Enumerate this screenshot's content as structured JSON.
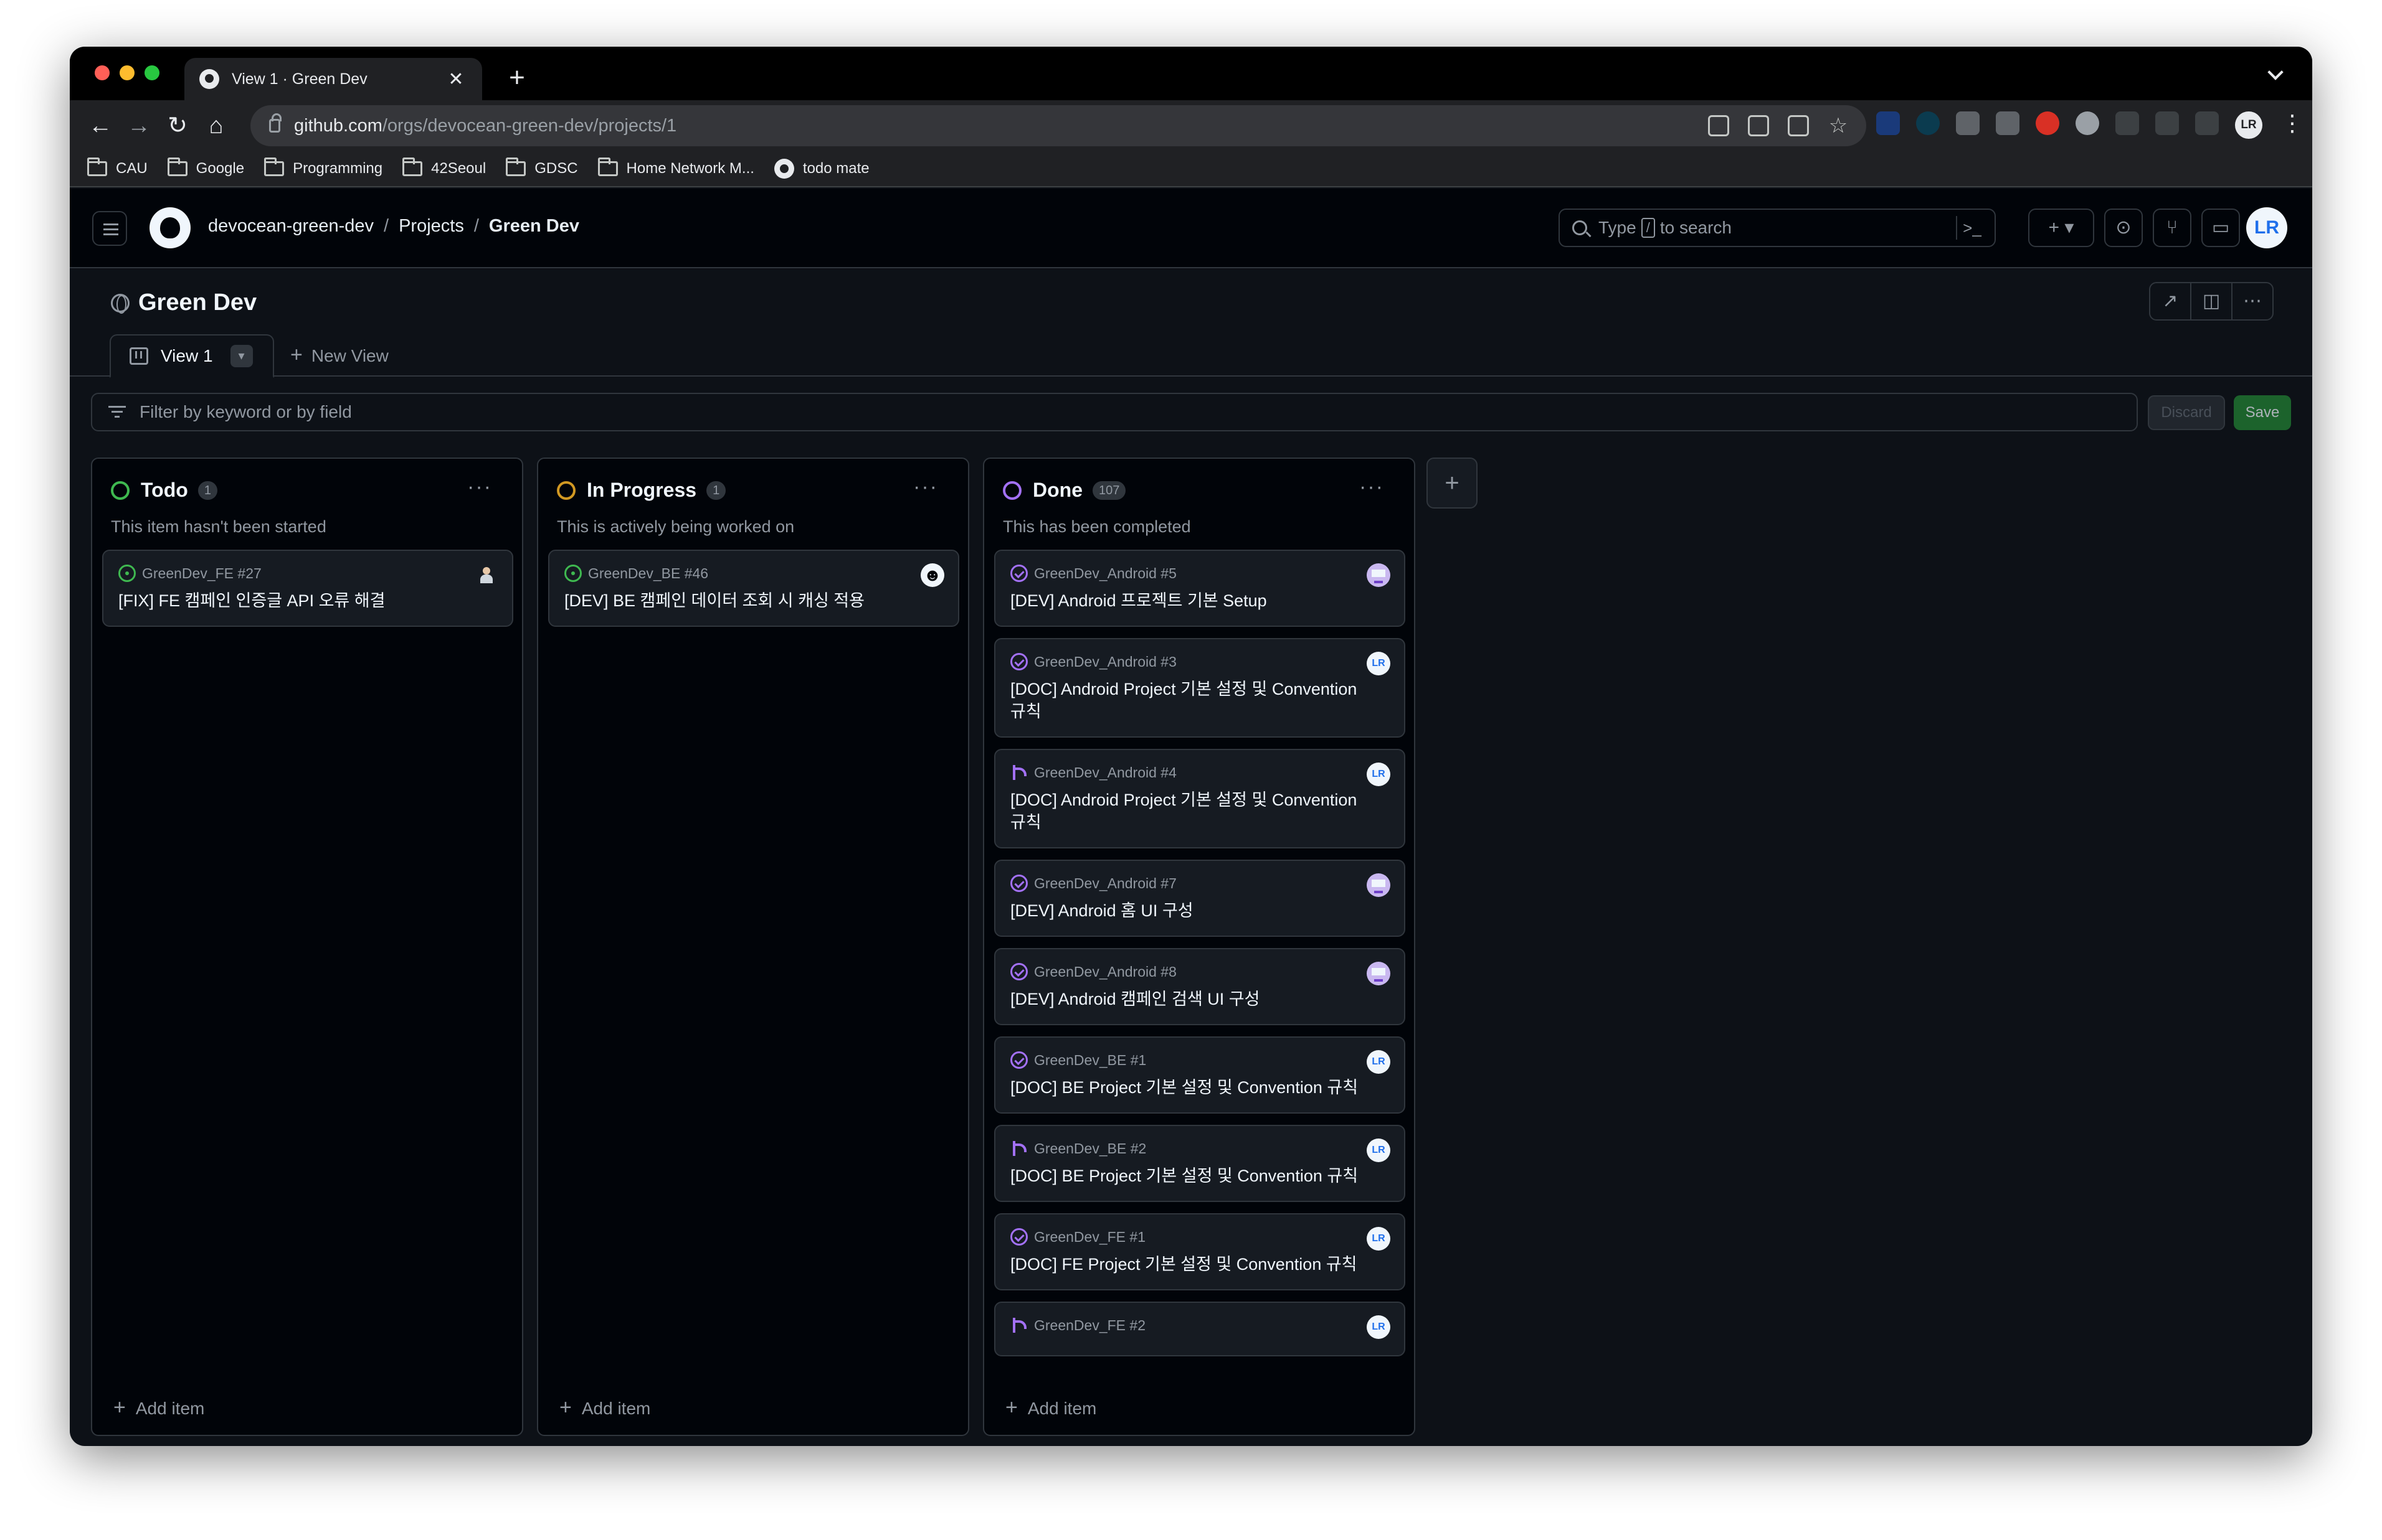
{
  "browser": {
    "tab_title": "View 1 · Green Dev",
    "url_host": "github.com",
    "url_path": "/orgs/devocean-green-dev/projects/1",
    "profile_initials": "LR",
    "bookmarks": [
      "CAU",
      "Google",
      "Programming",
      "42Seoul",
      "GDSC",
      "Home Network M...",
      "todo mate"
    ]
  },
  "header": {
    "breadcrumb": [
      "devocean-green-dev",
      "Projects",
      "Green Dev"
    ],
    "search_prefix": "Type",
    "search_key": "/",
    "search_suffix": "to search",
    "avatar_initials": "LR"
  },
  "project": {
    "title": "Green Dev",
    "view_tab": "View 1",
    "new_view": "New View",
    "filter_placeholder": "Filter by keyword or by field",
    "discard": "Discard",
    "save": "Save"
  },
  "columns": [
    {
      "name": "Todo",
      "count": "1",
      "description": "This item hasn't been started",
      "color": "#3fb950",
      "cards": [
        {
          "ref": "GreenDev_FE #27",
          "title": "[FIX] FE 캠페인 인증글 API 오류 해결",
          "state": "open",
          "assignee": "person"
        }
      ]
    },
    {
      "name": "In Progress",
      "count": "1",
      "description": "This is actively being worked on",
      "color": "#d29922",
      "cards": [
        {
          "ref": "GreenDev_BE #46",
          "title": "[DEV] BE 캠페인 데이터 조회 시 캐싱 적용",
          "state": "open",
          "assignee": "smile"
        }
      ]
    },
    {
      "name": "Done",
      "count": "107",
      "description": "This has been completed",
      "color": "#a371f7",
      "cards": [
        {
          "ref": "GreenDev_Android #5",
          "title": "[DEV] Android 프로젝트 기본 Setup",
          "state": "closed",
          "assignee": "pixel"
        },
        {
          "ref": "GreenDev_Android #3",
          "title": "[DOC] Android Project 기본 설정 및 Convention 규칙",
          "state": "closed",
          "assignee": "LR"
        },
        {
          "ref": "GreenDev_Android #4",
          "title": "[DOC] Android Project 기본 설정 및 Convention 규칙",
          "state": "merged",
          "assignee": "LR"
        },
        {
          "ref": "GreenDev_Android #7",
          "title": "[DEV] Android 홈 UI 구성",
          "state": "closed",
          "assignee": "pixel"
        },
        {
          "ref": "GreenDev_Android #8",
          "title": "[DEV] Android 캠페인 검색 UI 구성",
          "state": "closed",
          "assignee": "pixel"
        },
        {
          "ref": "GreenDev_BE #1",
          "title": "[DOC] BE Project 기본 설정 및 Convention 규칙",
          "state": "closed",
          "assignee": "LR"
        },
        {
          "ref": "GreenDev_BE #2",
          "title": "[DOC] BE Project 기본 설정 및 Convention 규칙",
          "state": "merged",
          "assignee": "LR"
        },
        {
          "ref": "GreenDev_FE #1",
          "title": "[DOC] FE Project 기본 설정 및 Convention 규칙",
          "state": "closed",
          "assignee": "LR"
        },
        {
          "ref": "GreenDev_FE #2",
          "title": "",
          "state": "merged",
          "assignee": "LR"
        }
      ]
    }
  ],
  "add_item": "Add item"
}
